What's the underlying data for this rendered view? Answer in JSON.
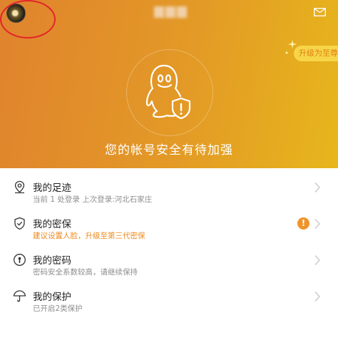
{
  "header": {
    "title": "您的帐号安全有待加强",
    "upgrade_label": "升级为至尊保",
    "colors": {
      "gradient_start": "#e0832e",
      "gradient_end": "#e7b61c",
      "annotation": "#e3242b"
    }
  },
  "menu": {
    "items": [
      {
        "title": "我的足迹",
        "subtitle": "当前 1 处登录 上次登录:河北石家庄",
        "icon": "location-pin-icon"
      },
      {
        "title": "我的密保",
        "subtitle": "建议设置人脸，升级至第三代密保",
        "icon": "shield-check-icon",
        "badge": "!"
      },
      {
        "title": "我的密码",
        "subtitle": "密码安全系数较高，请继续保持",
        "icon": "password-icon"
      },
      {
        "title": "我的保护",
        "subtitle": "已开启2类保护",
        "icon": "umbrella-icon"
      }
    ]
  }
}
